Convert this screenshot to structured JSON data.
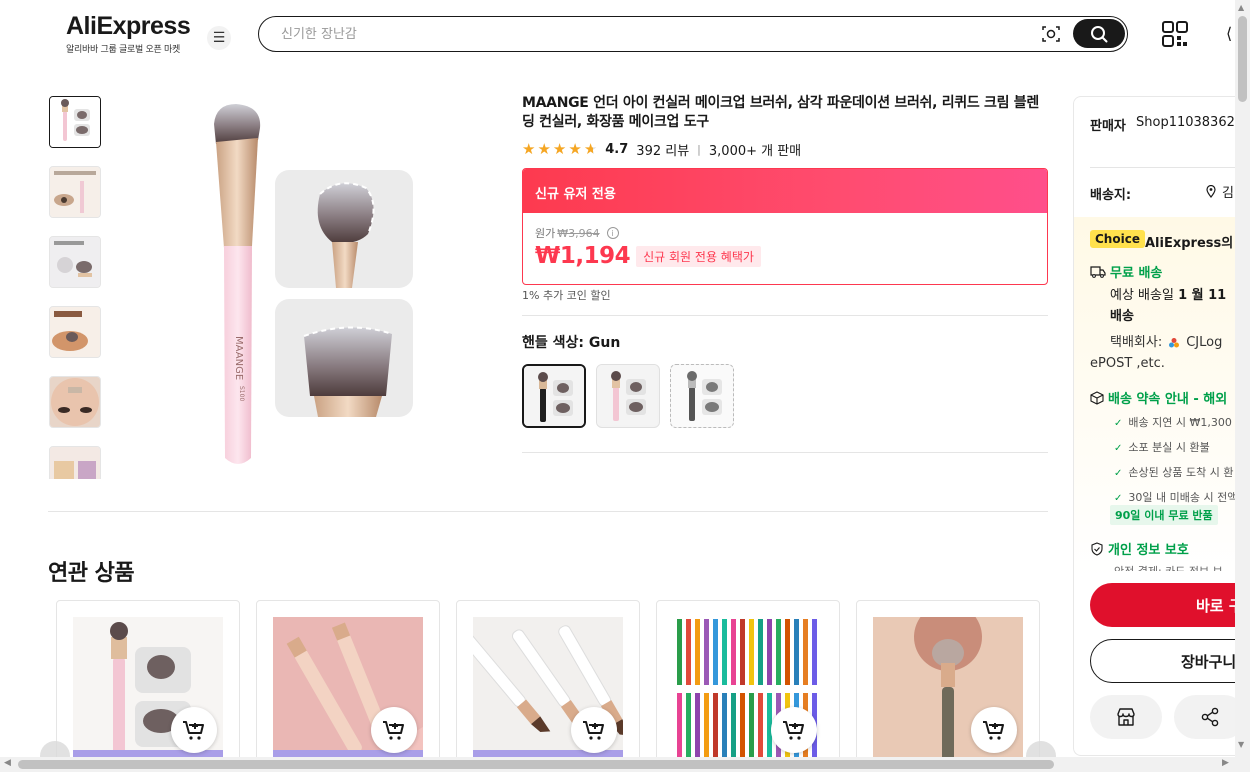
{
  "header": {
    "logo_text": "AliExpress",
    "logo_sub": "알리바바 그룹 글로벌 오픈 마켓",
    "search_placeholder": "신기한 장난감"
  },
  "product": {
    "title": "MAANGE 언더 아이 컨실러 메이크업 브러쉬, 삼각 파운데이션 브러쉬, 리퀴드 크림 블렌딩 컨실러, 화장품 메이크업 도구",
    "brand_on_handle": "MAANGE",
    "rating": "4.7",
    "reviews": "392 리뷰",
    "sold": "3,000+ 개 판매",
    "rating_stars": 4.7
  },
  "promo": {
    "header": "신규 유저 전용",
    "original_label": "원가",
    "original_price": "₩3,964",
    "price": "₩1,194",
    "price_tag": "신규 회원 전용 혜택가",
    "coin_discount": "1% 추가 코인 할인"
  },
  "variant": {
    "label": "핸들 색상: Gun",
    "swatches": [
      "Gun",
      "Pink",
      "Gray"
    ],
    "selected": "Gun"
  },
  "related": {
    "title": "연관 상품"
  },
  "panel": {
    "seller_label": "판매자",
    "seller_name": "Shop11038362",
    "ship_to_label": "배송지:",
    "ship_to_value": "김",
    "choice_badge": "Choice",
    "choice_text": "AliExpress의 약",
    "free_shipping": "무료 배송",
    "eta_line1_prefix": "예상 배송일 ",
    "eta_date": "1 월 11",
    "eta_line2": "배송",
    "courier_line1": "택배회사:",
    "courier_name": "CJLog",
    "courier_line2": "ePOST ,etc.",
    "promise": "배송 약속 안내 - 해외",
    "promise_items": [
      "배송 지연 시 ₩1,300 ",
      "소포 분실 시 환불",
      "손상된 상품 도착 시 환",
      "30일 내 미배송 시 전액"
    ],
    "returns": "90일 이내 무료 반품",
    "privacy": "개인 정보 보호",
    "privacy_sub": "안전 결제: 카드 정보 보",
    "buy_now": "바로 구",
    "add_cart": "장바구니"
  },
  "colors": {
    "brand_red": "#fd384f",
    "buy_red": "#e0102c",
    "choice_yellow": "#ffe14d",
    "green": "#00a04a"
  }
}
